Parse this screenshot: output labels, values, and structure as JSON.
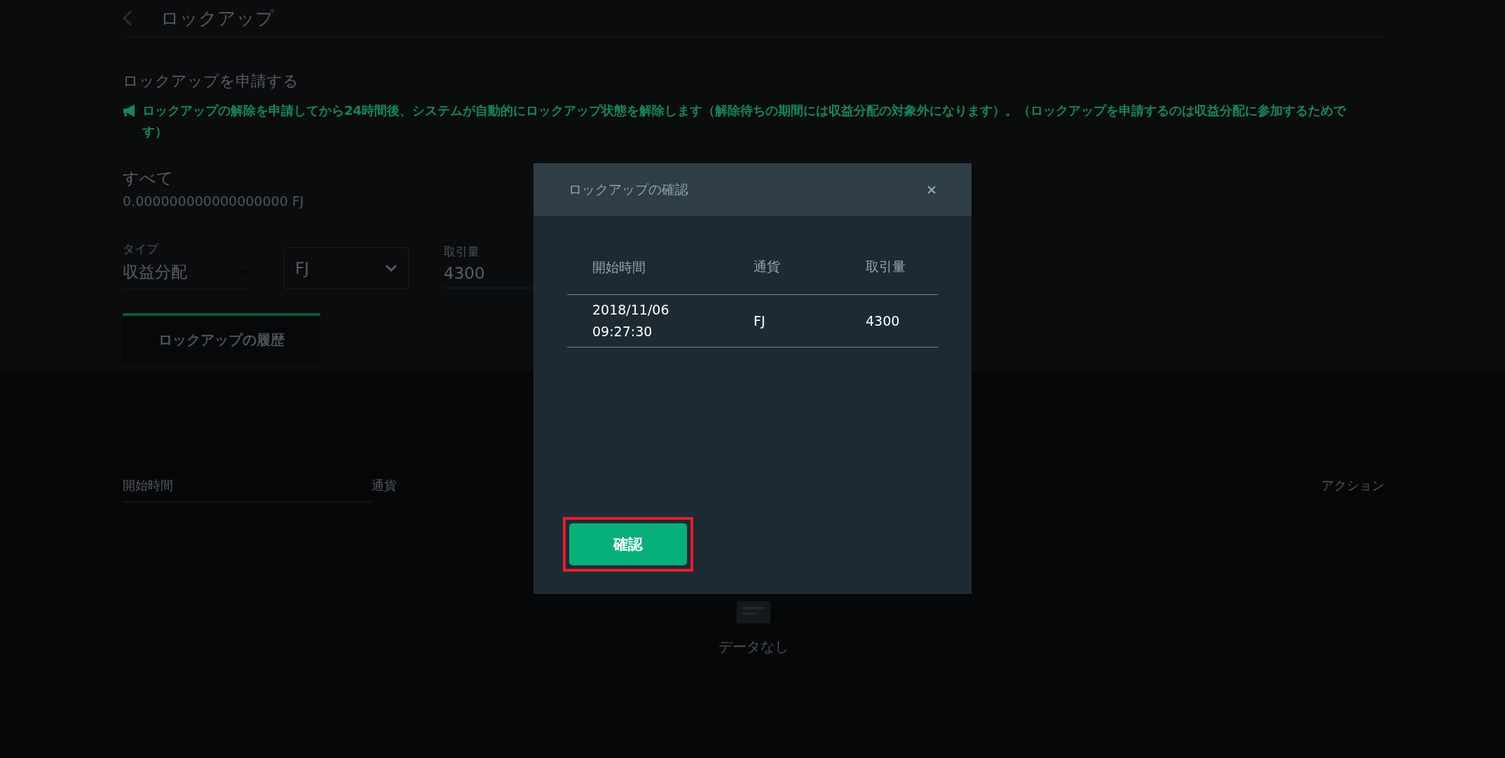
{
  "page": {
    "title": "ロックアップ",
    "section_title": "ロックアップを申請する",
    "notice": "ロックアップの解除を申請してから24時間後、システムが自動的にロックアップ状態を解除します（解除待ちの期間には収益分配の対象外になります）。（ロックアップを申請するのは収益分配に参加するためです）",
    "balance_label": "すべて",
    "balance_value": "0.000000000000000000 FJ",
    "type_field": {
      "label": "タイプ",
      "value": "収益分配"
    },
    "currency_field": {
      "value": "FJ"
    },
    "amount_field": {
      "label": "取引量",
      "value": "4300"
    },
    "tabs": [
      {
        "label": "ロックアップの履歴",
        "selected": true
      }
    ],
    "table": {
      "columns": [
        "開始時間",
        "通貨",
        "アクション"
      ],
      "empty_text": "データなし"
    }
  },
  "dialog": {
    "title": "ロックアップの確認",
    "columns": [
      "開始時間",
      "通貨",
      "取引量"
    ],
    "rows": [
      {
        "cells": [
          "2018/11/06 09:27:30",
          "FJ",
          "4300"
        ]
      }
    ],
    "confirm_button": "確認"
  }
}
